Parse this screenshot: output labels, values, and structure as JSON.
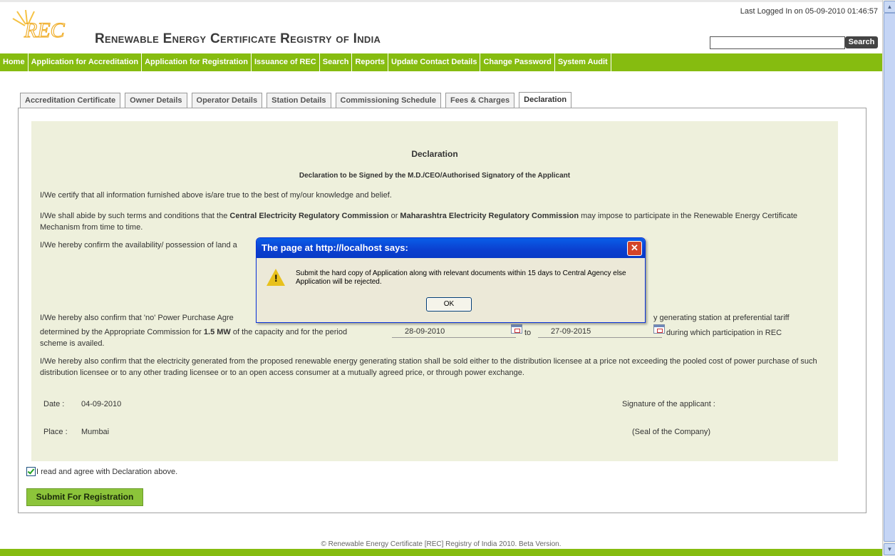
{
  "header": {
    "last_logged": "Last Logged In on 05-09-2010 01:46:57",
    "logo_text": "REC",
    "site_title": "Renewable Energy Certificate Registry of India",
    "search_placeholder": "",
    "search_label": "Search"
  },
  "nav": {
    "items": [
      "Home",
      "Application for Accreditation",
      "Application for Registration",
      "Issuance of REC",
      "Search",
      "Reports",
      "Update Contact Details",
      "Change Password",
      "System Audit"
    ]
  },
  "tabs": [
    "Accreditation Certificate",
    "Owner Details",
    "Operator Details",
    "Station Details",
    "Commissioning Schedule",
    "Fees & Charges",
    "Declaration"
  ],
  "active_tab": "Declaration",
  "declaration": {
    "title": "Declaration",
    "subtitle": "Declaration to be Signed by the M.D./CEO/Authorised Signatory of the Applicant",
    "para1": "I/We certify that all information furnished above is/are true to the best of my/our knowledge and belief.",
    "para2_a": "I/We shall abide by such terms and conditions that the ",
    "para2_b": "Central Electricity Regulatory Commission",
    "para2_c": " or ",
    "para2_d": "Maharashtra Electricity Regulatory Commission",
    "para2_e": " may impose to participate in the Renewable Energy Certificate Mechanism from time to time.",
    "para3": "I/We hereby confirm the availability/ possession of land a",
    "para4_a": "I/We hereby also confirm that 'no' Power Purchase Agre",
    "para4_b": "y generating station at preferential tariff",
    "para4_c": "determined by the Appropriate Commission for ",
    "para4_d": "1.5 MW",
    "para4_e": " of the capacity and for the period",
    "to_label": "to",
    "para4_f": "during which participation in REC",
    "para4_g": "scheme is availed.",
    "period_from": "28-09-2010",
    "period_to": "27-09-2015",
    "para5": "I/We hereby also confirm that the electricity generated from the proposed renewable energy generating station shall be sold either to the distribution licensee at a price not exceeding the pooled cost of power purchase of such distribution licensee or to any other trading licensee or to an open access consumer at a mutually agreed price, or through power exchange.",
    "date_label": "Date :",
    "date_value": "04-09-2010",
    "place_label": "Place :",
    "place_value": "Mumbai",
    "signature_label": "Signature of the applicant :",
    "seal_label": "(Seal of the Company)"
  },
  "agree": {
    "label": "I read and agree with Declaration above.",
    "checked": true
  },
  "submit_label": "Submit For Registration",
  "footer": "© Renewable Energy Certificate [REC] Registry of India 2010. Beta Version.",
  "dialog": {
    "title": "The page at http://localhost says:",
    "message": "Submit the hard copy of Application along with relevant documents within 15 days to Central Agency else Application will be rejected.",
    "ok_label": "OK",
    "warning_icon": "warning-icon"
  },
  "colors": {
    "nav_green": "#86bc10",
    "content_bg": "#eef0dc",
    "dialog_title_blue": "#0b3fcf"
  }
}
